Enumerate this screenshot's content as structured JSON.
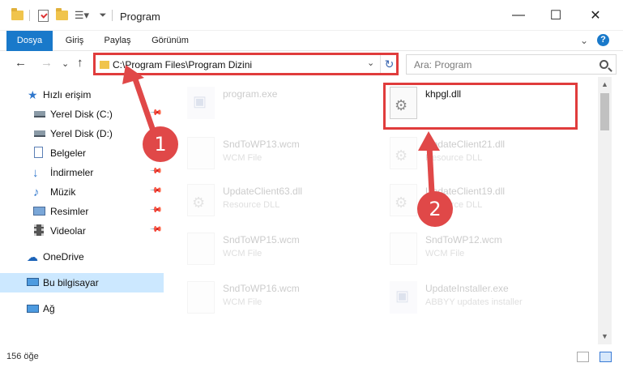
{
  "window": {
    "title": "Program",
    "minimize": "—",
    "maximize": "☐",
    "close": "✕"
  },
  "ribbon": {
    "tabs": [
      {
        "label": "Dosya",
        "active": true
      },
      {
        "label": "Giriş",
        "active": false
      },
      {
        "label": "Paylaş",
        "active": false
      },
      {
        "label": "Görünüm",
        "active": false
      }
    ],
    "expand": "⌄",
    "help": "?"
  },
  "nav": {
    "back": "←",
    "forward": "→",
    "recent": "⌄",
    "up": "↑",
    "address": "C:\\Program Files\\Program Dizini",
    "address_dropdown": "⌄",
    "refresh": "↻",
    "search_placeholder": "Ara: Program"
  },
  "sidebar": {
    "items": [
      {
        "label": "Hızlı erişim",
        "icon": "star-icon",
        "pinned": false
      },
      {
        "label": "Yerel Disk (C:)",
        "icon": "drive-icon",
        "pinned": true
      },
      {
        "label": "Yerel Disk (D:)",
        "icon": "drive-icon",
        "pinned": true
      },
      {
        "label": "Belgeler",
        "icon": "documents-icon",
        "pinned": true
      },
      {
        "label": "İndirmeler",
        "icon": "download-icon",
        "pinned": true
      },
      {
        "label": "Müzik",
        "icon": "music-icon",
        "pinned": true
      },
      {
        "label": "Resimler",
        "icon": "pictures-icon",
        "pinned": true
      },
      {
        "label": "Videolar",
        "icon": "videos-icon",
        "pinned": true
      },
      {
        "label": "OneDrive",
        "icon": "cloud-icon",
        "pinned": false
      },
      {
        "label": "Bu bilgisayar",
        "icon": "computer-icon",
        "pinned": false,
        "selected": true
      },
      {
        "label": "Ağ",
        "icon": "network-icon",
        "pinned": false
      }
    ]
  },
  "files": [
    {
      "name": "program.exe",
      "type": "",
      "icon": "exe-icon",
      "faded": true
    },
    {
      "name": "khpgl.dll",
      "type": "",
      "icon": "dll-icon",
      "faded": false
    },
    {
      "name": "SndToWP13.wcm",
      "type": "WCM File",
      "icon": "file-icon",
      "faded": true
    },
    {
      "name": "UpdateClient21.dll",
      "type": "Resource DLL",
      "icon": "dll-icon",
      "faded": true
    },
    {
      "name": "UpdateClient63.dll",
      "type": "Resource DLL",
      "icon": "dll-icon",
      "faded": true
    },
    {
      "name": "UpdateClient19.dll",
      "type": "Resource DLL",
      "icon": "dll-icon",
      "faded": true
    },
    {
      "name": "SndToWP15.wcm",
      "type": "WCM File",
      "icon": "file-icon",
      "faded": true
    },
    {
      "name": "SndToWP12.wcm",
      "type": "WCM File",
      "icon": "file-icon",
      "faded": true
    },
    {
      "name": "SndToWP16.wcm",
      "type": "WCM File",
      "icon": "file-icon",
      "faded": true
    },
    {
      "name": "UpdateInstaller.exe",
      "type": "ABBYY updates installer",
      "icon": "exe-icon",
      "faded": true
    }
  ],
  "status": {
    "item_count": "156 öğe"
  },
  "annotations": {
    "marker1": "1",
    "marker2": "2",
    "highlight_color": "#e03c3c"
  },
  "colors": {
    "accent": "#1979ca",
    "selection": "#cce8ff"
  }
}
